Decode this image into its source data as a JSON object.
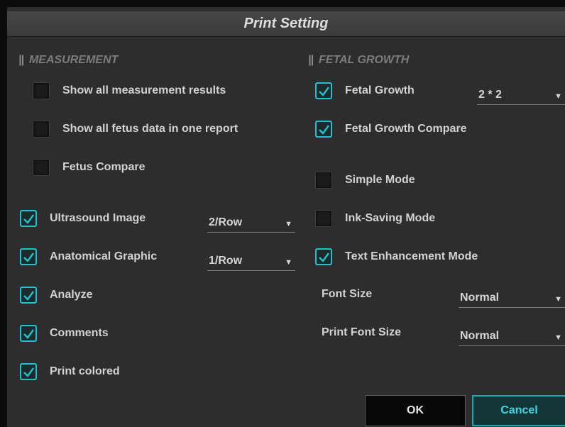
{
  "title": "Print Setting",
  "measurement": {
    "title": "MEASUREMENT",
    "items": [
      {
        "label": "Show all measurement results",
        "checked": false
      },
      {
        "label": "Show all fetus data in one report",
        "checked": false
      },
      {
        "label": "Fetus Compare",
        "checked": false
      }
    ]
  },
  "general": {
    "items": [
      {
        "label": "Ultrasound Image",
        "checked": true
      },
      {
        "label": "Anatomical Graphic",
        "checked": true
      },
      {
        "label": "Analyze",
        "checked": true
      },
      {
        "label": "Comments",
        "checked": true
      },
      {
        "label": "Print colored",
        "checked": true
      }
    ],
    "ultrasound_image_select": "2/Row",
    "anatomical_graphic_select": "1/Row"
  },
  "fetal_growth": {
    "title": "FETAL GROWTH",
    "items": [
      {
        "label": "Fetal Growth",
        "checked": true
      },
      {
        "label": "Fetal Growth Compare",
        "checked": true
      },
      {
        "label": "Simple Mode",
        "checked": false
      },
      {
        "label": "Ink-Saving Mode",
        "checked": false
      },
      {
        "label": "Text Enhancement Mode",
        "checked": true
      }
    ],
    "layout_select": "2 * 2",
    "font_size_label": "Font Size",
    "font_size_value": "Normal",
    "print_font_size_label": "Print Font Size",
    "print_font_size_value": "Normal"
  },
  "buttons": {
    "ok": "OK",
    "cancel": "Cancel"
  },
  "colors": {
    "accent": "#21c3cf",
    "background": "#2d2d2d",
    "title_bar": "#3f3f3f"
  },
  "icons": {
    "dropdown": "triangle-down-icon",
    "check": "checkmark-icon",
    "section": "double-bar-icon"
  }
}
